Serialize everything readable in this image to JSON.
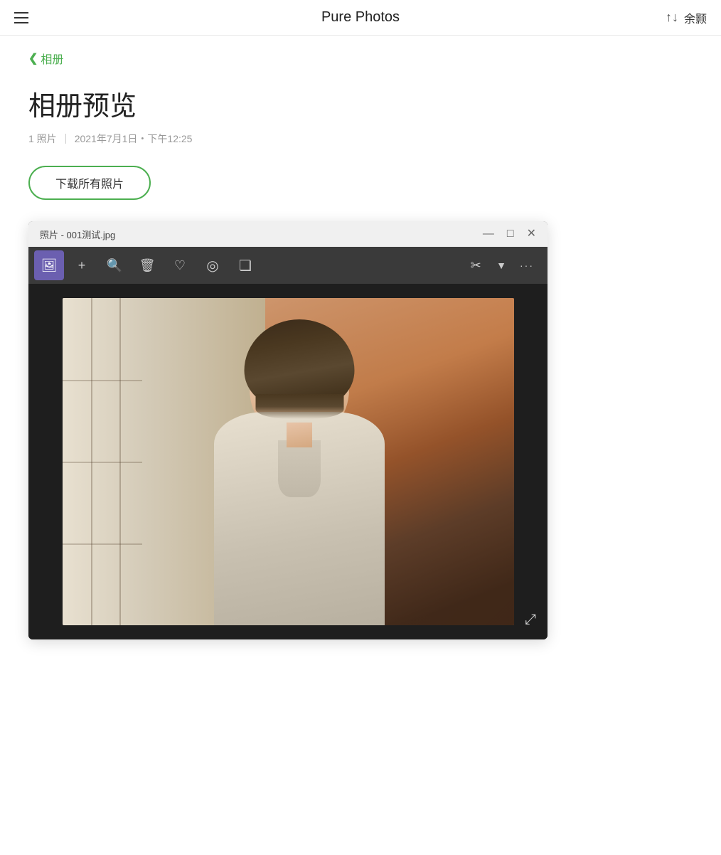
{
  "app": {
    "title": "Pure Photos"
  },
  "topbar": {
    "hamburger_label": "menu",
    "sort_icon": "↑↓",
    "user_name": "余颢"
  },
  "breadcrumb": {
    "arrow": "❮",
    "text": "相册"
  },
  "page": {
    "title": "相册预览",
    "photo_count": "1 照片",
    "date": "2021年7月1日・下午12:25",
    "download_btn": "下载所有照片"
  },
  "photo_window": {
    "filename": "照片 - 001测试.jpg",
    "controls": {
      "minimize": "—",
      "maximize": "□",
      "close": "✕"
    },
    "toolbar": {
      "view_icon": "🖼",
      "add_icon": "+",
      "zoom_icon": "🔍",
      "delete_icon": "🗑",
      "heart_icon": "♡",
      "pin_icon": "⊙",
      "crop_icon": "⊡",
      "edit_icon": "✂",
      "dropdown_icon": "▾",
      "more_icon": "•••"
    },
    "expand_icon": "⤢"
  }
}
